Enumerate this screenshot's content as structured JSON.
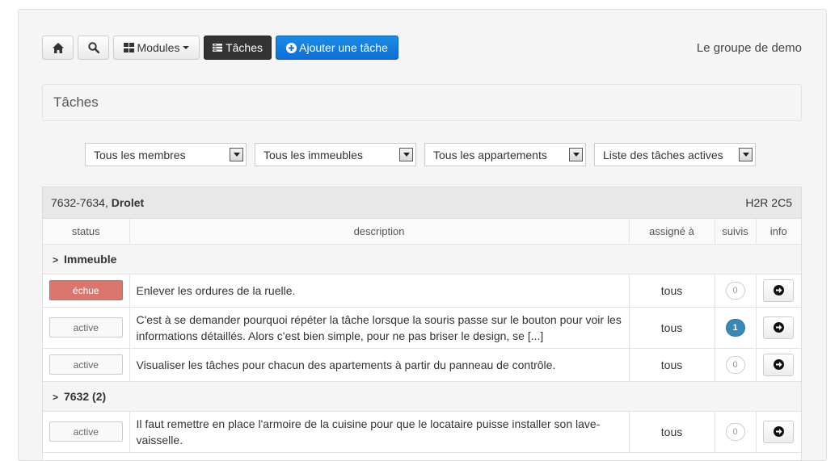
{
  "toolbar": {
    "modules_label": "Modules",
    "tasks_label": "Tâches",
    "add_task_label": "Ajouter une tâche"
  },
  "group_name": "Le groupe de demo",
  "section_title": "Tâches",
  "filters": [
    {
      "value": "Tous les membres"
    },
    {
      "value": "Tous les immeubles"
    },
    {
      "value": "Tous les appartements"
    },
    {
      "value": "Liste des tâches actives"
    }
  ],
  "panel": {
    "address_number": "7632-7634, ",
    "address_street": "Drolet",
    "postal_code": "H2R 2C5"
  },
  "columns": {
    "status": "status",
    "description": "description",
    "assigned": "assigné à",
    "followups": "suivis",
    "info": "info"
  },
  "groups": [
    {
      "label": "Immeuble",
      "tasks": [
        {
          "status": "échue",
          "description": "Enlever les ordures de la ruelle.",
          "assigned": "tous",
          "followups": "0"
        },
        {
          "status": "active",
          "description": "C'est à se demander pourquoi répéter la tâche lorsque la souris passe sur le bouton pour voir les informations détaillés. Alors c'est bien simple, pour ne pas briser le design, se [...]",
          "assigned": "tous",
          "followups": "1"
        },
        {
          "status": "active",
          "description": "Visualiser les tâches pour chacun des apartements à partir du panneau de contrôle.",
          "assigned": "tous",
          "followups": "0"
        }
      ]
    },
    {
      "label": "7632 (2)",
      "tasks": [
        {
          "status": "active",
          "description": "Il faut remettre en place l'armoire de la cuisine pour que le locataire puisse installer son lave-vaisselle.",
          "assigned": "tous",
          "followups": "0"
        }
      ]
    }
  ],
  "colors": {
    "primary": "#0f6fd4",
    "overdue": "#d9776e",
    "badge": "#3788b5"
  },
  "icons": {
    "home": "home-icon",
    "search": "search-icon",
    "modules": "grid-icon",
    "tasks": "list-icon",
    "add": "plus-circle-icon",
    "info": "arrow-right-circle-icon"
  }
}
